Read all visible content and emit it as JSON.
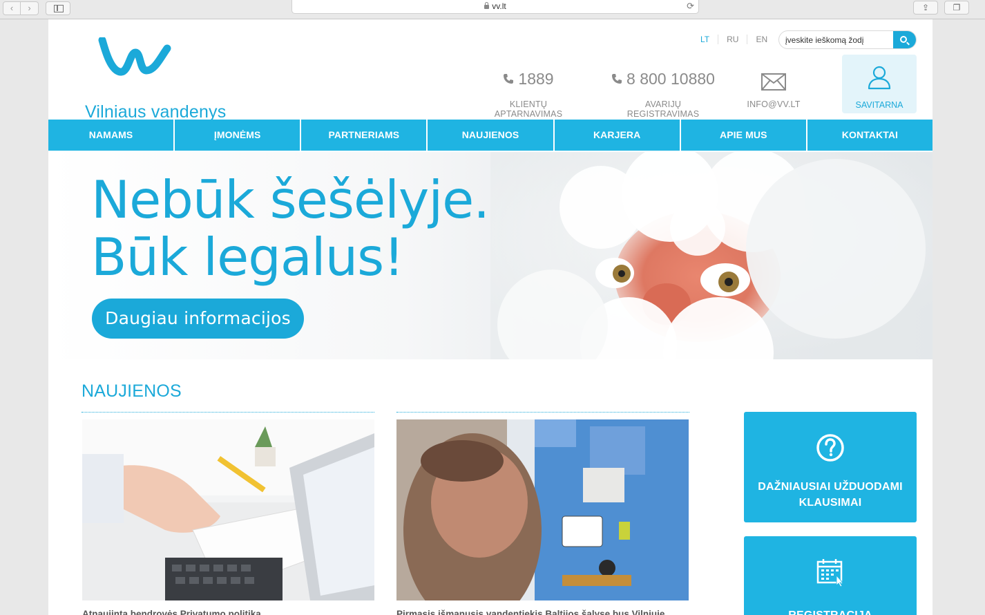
{
  "browser": {
    "url": "vv.lt",
    "back_label": "‹",
    "forward_label": "›"
  },
  "header": {
    "logo_text": "Vilniaus vandenys",
    "languages": [
      "LT",
      "RU",
      "EN"
    ],
    "active_language": "LT",
    "search_placeholder": "įveskite ieškomą žodį",
    "contacts": [
      {
        "value": "1889",
        "label": "KLIENTŲ APTARNAVIMAS",
        "icon": "phone-icon"
      },
      {
        "value": "8 800 10880",
        "label": "AVARIJŲ REGISTRAVIMAS",
        "icon": "phone-icon"
      },
      {
        "value": "",
        "label": "INFO@VV.LT",
        "icon": "mail-icon"
      }
    ],
    "savitarna_label": "SAVITARNA"
  },
  "menu": {
    "items": [
      "NAMAMS",
      "ĮMONĖMS",
      "PARTNERIAMS",
      "NAUJIENOS",
      "KARJERA",
      "APIE MUS",
      "KONTAKTAI"
    ]
  },
  "hero": {
    "line1": "Nebūk šešėlyje.",
    "line2": "Būk legalus!",
    "button": "Daugiau informacijos"
  },
  "news": {
    "title": "NAUJIENOS",
    "items": [
      {
        "headline": "Atnaujinta bendrovės Privatumo politika"
      },
      {
        "headline": "Pirmasis išmanusis vandentiekis Baltijos šalyse bus Vilniuje"
      }
    ]
  },
  "tiles": [
    {
      "label_line1": "DAŽNIAUSIAI UŽDUODAMI",
      "label_line2": "KLAUSIMAI",
      "icon": "question-icon"
    },
    {
      "label_line1": "REGISTRACIJA",
      "label_line2": "",
      "icon": "calendar-icon"
    }
  ],
  "colors": {
    "brand": "#1ba9d9",
    "menu": "#1fb4e2",
    "text_gray": "#8a8a8a"
  }
}
